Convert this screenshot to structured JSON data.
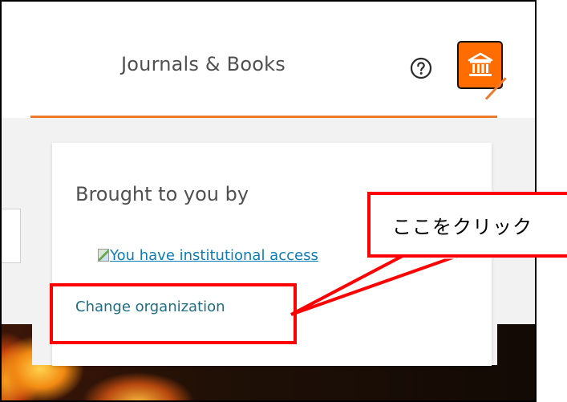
{
  "header": {
    "nav_link": "Journals & Books",
    "help_icon": "question-circle-icon",
    "institution_icon": "institution-icon",
    "accent_color": "#ff6c00"
  },
  "dropdown": {
    "heading": "Brought to you by",
    "access_link": "You have institutional access",
    "change_org": "Change organization",
    "underline_color": "#ec7a2c",
    "link_color": "#0c7dbb"
  },
  "annotation": {
    "callout_text": "ここをクリック",
    "highlight_color": "#ff0000"
  }
}
